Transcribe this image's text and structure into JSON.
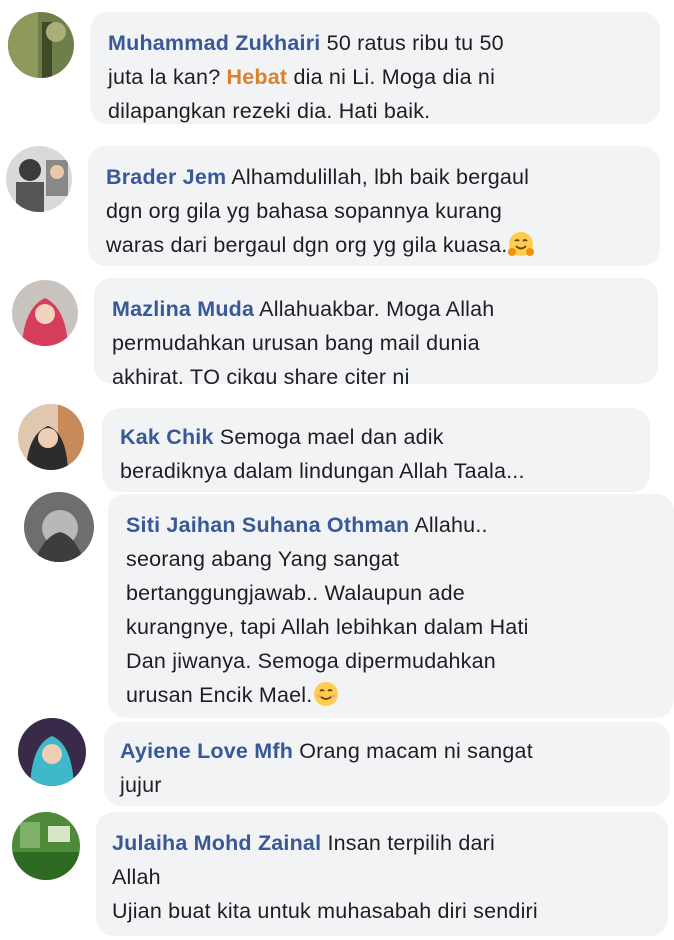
{
  "comments": [
    {
      "author": "Muhammad Zukhairi",
      "lines": [
        "50 ratus ribu tu 50",
        "juta la kan? ",
        "dilapangkan rezeki dia. Hati baik."
      ],
      "highlight": "Hebat",
      "after_highlight": " dia ni Li. Moga dia ni"
    },
    {
      "author": "Brader Jem",
      "lines": [
        "Alhamdulillah, lbh baik bergaul",
        "dgn org gila yg bahasa sopannya kurang",
        "waras dari bergaul dgn org yg gila kuasa."
      ],
      "emoji": "hugging-face"
    },
    {
      "author": "Mazlina Muda",
      "lines": [
        "Allahuakbar. Moga Allah",
        "permudahkan urusan bang mail dunia",
        "akhirat. TQ cikgu share citer ni"
      ]
    },
    {
      "author": "Kak Chik",
      "lines": [
        "Semoga mael dan adik",
        "beradiknya dalam lindungan Allah Taala..."
      ]
    },
    {
      "author": "Siti Jaihan Suhana Othman",
      "lines": [
        "Allahu..",
        "seorang abang Yang sangat",
        "bertanggungjawab.. Walaupun ade",
        "kurangnye, tapi Allah lebihkan dalam Hati",
        "Dan jiwanya. Semoga dipermudahkan",
        "urusan Encik Mael."
      ],
      "emoji": "smiling-face"
    },
    {
      "author": "Ayiene Love Mfh",
      "lines": [
        "Orang macam ni sangat",
        "jujur"
      ]
    },
    {
      "author": "Julaiha Mohd Zainal",
      "lines": [
        "Insan terpilih dari",
        "Allah",
        "Ujian buat kita untuk muhasabah diri sendiri"
      ]
    }
  ]
}
